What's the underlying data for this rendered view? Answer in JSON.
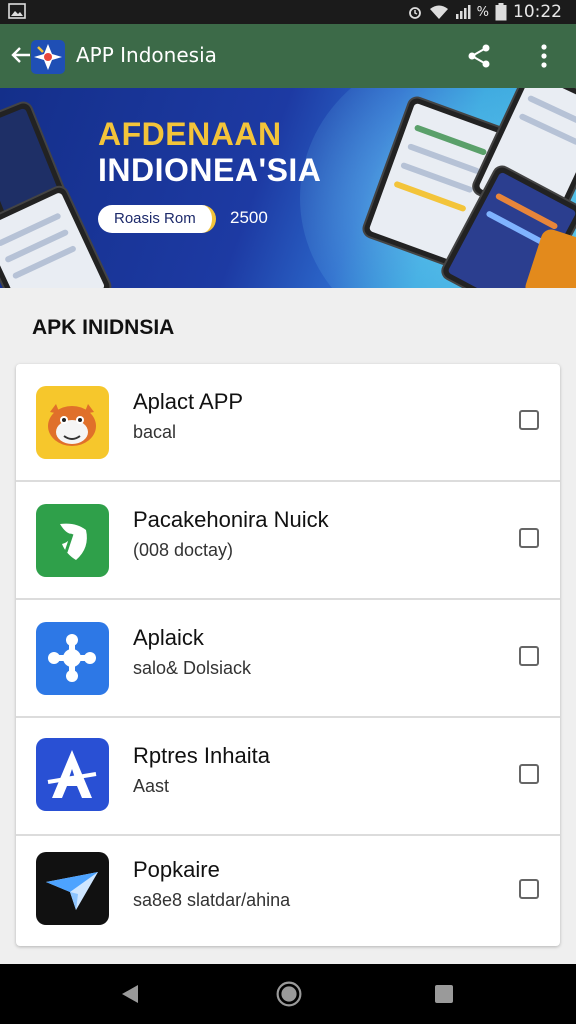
{
  "status_bar": {
    "time": "10:22",
    "battery_text": "%"
  },
  "app_bar": {
    "title": "APP Indonesia",
    "icons": [
      "back-arrow-icon",
      "app-logo-icon",
      "share-icon",
      "more-vert-icon"
    ]
  },
  "banner": {
    "headline_line1": "AFDENAAN",
    "headline_line2": "INDIONEA'SIA",
    "pill_label": "Roasis Rom",
    "number": "2500"
  },
  "section": {
    "title": "APK INIDNSIA"
  },
  "apps": [
    {
      "name": "Aplact APP",
      "subtitle": "bacal",
      "icon": "mascot-icon",
      "checked": false
    },
    {
      "name": "Pacakehonira Nuick",
      "subtitle": "(008 doctay)",
      "icon": "leaf-icon",
      "checked": false
    },
    {
      "name": "Aplaick",
      "subtitle": "salo& Dolsiack",
      "icon": "puzzle-icon",
      "checked": false
    },
    {
      "name": "Rptres Inhaita",
      "subtitle": "Aast",
      "icon": "letter-a-icon",
      "checked": false
    },
    {
      "name": "Popkaire",
      "subtitle": "sa8e8 slatdar/ahina",
      "icon": "paper-plane-icon",
      "checked": false
    }
  ],
  "colors": {
    "app_bar": "#3c6a48",
    "status_bar": "#1b1b1b",
    "banner_gold": "#f3c43a"
  }
}
